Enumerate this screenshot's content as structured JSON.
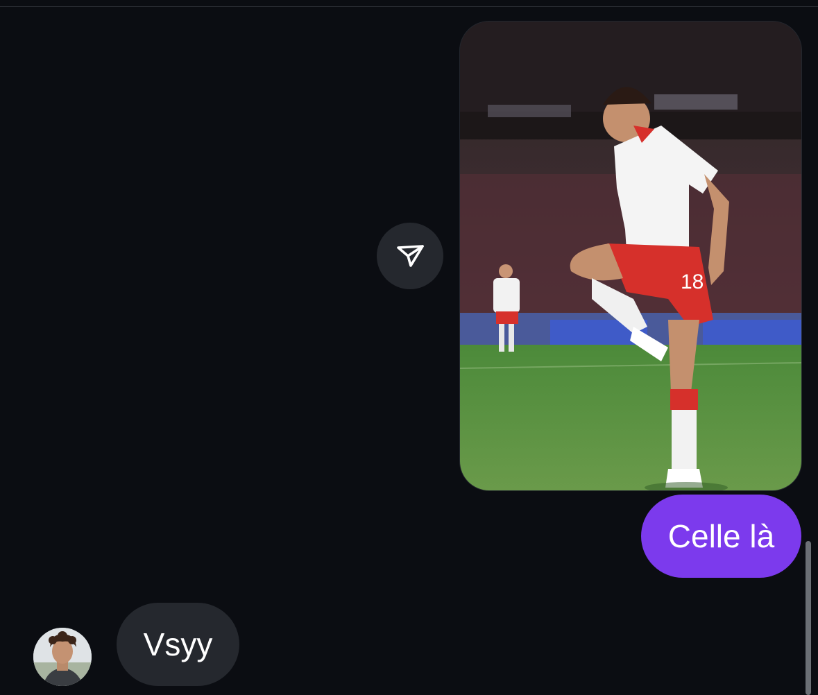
{
  "messages": {
    "outgoing_photo": {
      "image": "football-player-celebration-photo",
      "jersey_number": "18"
    },
    "share_icon": "paper-plane-icon",
    "outgoing_text": "Celle là",
    "incoming": {
      "avatar": "contact-avatar",
      "text": "Vsyy"
    }
  },
  "colors": {
    "background": "#0b0d12",
    "outgoing_bubble": "#7c3aed",
    "incoming_bubble": "#25282e",
    "share_button": "#25282e"
  }
}
